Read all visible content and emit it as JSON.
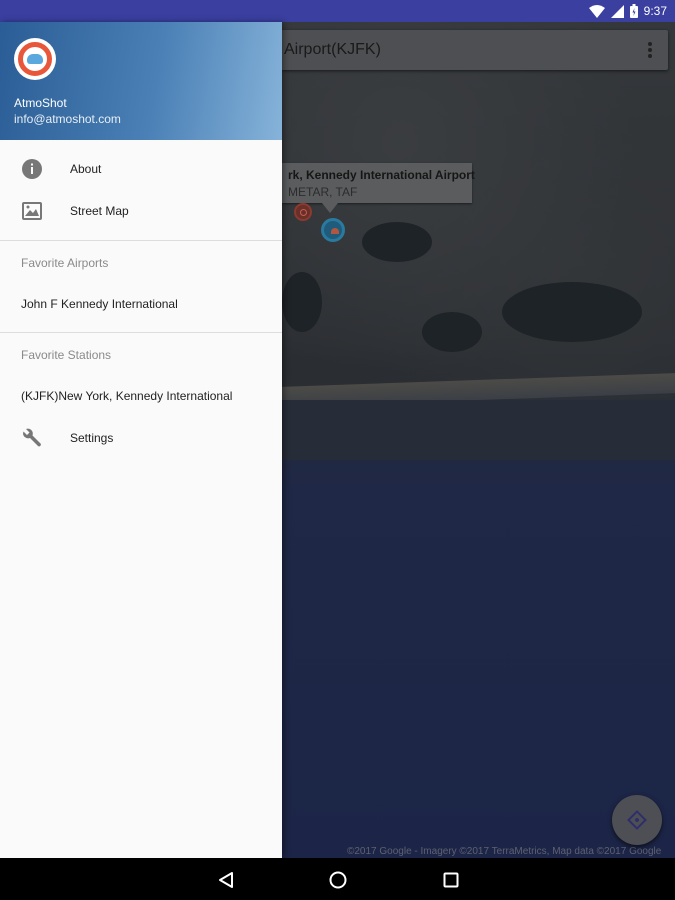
{
  "status_bar": {
    "time": "9:37",
    "icons": [
      "wifi-icon",
      "signal-icon",
      "battery-icon"
    ]
  },
  "map": {
    "search_text": "Airport(KJFK)",
    "info_window": {
      "title": "rk, Kennedy International Airport",
      "subtitle": "METAR, TAF"
    },
    "copyright": "©2017 Google - Imagery ©2017 TerraMetrics, Map data ©2017 Google",
    "fab_icon": "my-location-icon"
  },
  "drawer": {
    "header": {
      "app_name": "AtmoShot",
      "email": "info@atmoshot.com"
    },
    "items": [
      {
        "label": "About",
        "icon": "info-icon"
      },
      {
        "label": "Street Map",
        "icon": "map-icon"
      }
    ],
    "favorite_airports": {
      "title": "Favorite Airports",
      "items": [
        "John F Kennedy International"
      ]
    },
    "favorite_stations": {
      "title": "Favorite Stations",
      "items": [
        "(KJFK)New York, Kennedy International"
      ]
    },
    "settings": {
      "label": "Settings",
      "icon": "wrench-icon"
    }
  },
  "nav_bar": {
    "buttons": [
      "back-icon",
      "home-icon",
      "recents-icon"
    ]
  },
  "colors": {
    "status_bar": "#3a3fa0",
    "header_start": "#2a5d95",
    "header_end": "#86b3d9",
    "logo_accent": "#e8573a"
  }
}
